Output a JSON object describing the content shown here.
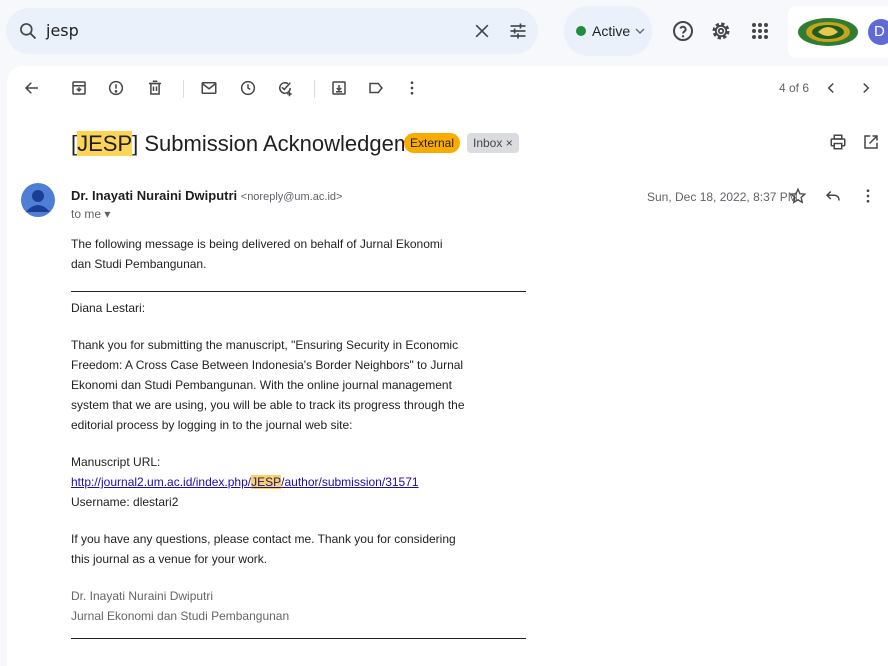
{
  "search": {
    "query": "jesp"
  },
  "status": {
    "label": "Active",
    "color": "#1e8e3e"
  },
  "account": {
    "avatar_letter": "D"
  },
  "toolbar": {
    "pager": "4 of 6"
  },
  "email": {
    "subject_prefix": "[",
    "subject_tag": "JESP",
    "subject_rest": "] Submission Acknowledgement",
    "label_external": "External",
    "label_inbox": "Inbox ×",
    "sender_name": "Dr. Inayati Nuraini Dwiputri",
    "sender_email": "<noreply@um.ac.id>",
    "to": "to me",
    "date": "Sun, Dec 18, 2022, 8:37 PM",
    "intro": "The following message is being delivered on behalf of Jurnal Ekonomi dan Studi Pembangunan.",
    "greeting": "Diana Lestari:",
    "paragraph": "Thank you for submitting the manuscript, \"Ensuring Security in Economic Freedom: A Cross Case Between Indonesia's Border Neighbors\" to Jurnal Ekonomi dan Studi Pembangunan. With the online journal management system that we are using, you will be able to track its progress through the editorial process by logging in to the journal web site:",
    "manuscript_label": "Manuscript URL:",
    "url_prefix": "http://journal2.um.ac.id/index.php/",
    "url_tag": "JESP",
    "url_suffix": "/author/submission/31571",
    "username": "Username: dlestari2",
    "closing": "If you have any questions, please contact me. Thank you for considering this journal as a venue for your work.",
    "sig_name": "Dr. Inayati Nuraini Dwiputri",
    "sig_journal": "Jurnal Ekonomi dan Studi Pembangunan"
  },
  "icons": {
    "search": "search-icon",
    "clear": "close-icon",
    "tune": "tune-icon",
    "help": "help-icon",
    "settings": "gear-icon",
    "apps": "apps-grid-icon",
    "back": "arrow-left-icon",
    "archive": "archive-icon",
    "spam": "report-spam-icon",
    "delete": "trash-icon",
    "unread": "mail-icon",
    "snooze": "clock-icon",
    "task": "add-task-icon",
    "move": "move-to-icon",
    "label": "label-icon",
    "more": "more-vert-icon",
    "prev": "chevron-left-icon",
    "next": "chevron-right-icon",
    "print": "print-icon",
    "newwin": "open-new-window-icon",
    "star": "star-icon",
    "reply": "reply-icon"
  }
}
